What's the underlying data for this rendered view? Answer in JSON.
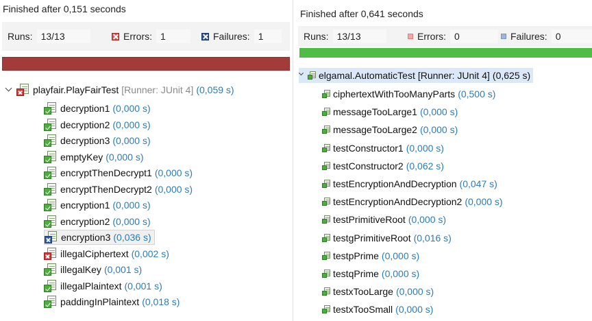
{
  "left": {
    "finished": "Finished after 0,151 seconds",
    "runs_label": "Runs:",
    "runs_value": "13/13",
    "errors_label": "Errors:",
    "errors_value": "1",
    "failures_label": "Failures:",
    "failures_value": "1",
    "progress_color": "#a33b3b",
    "suite": {
      "name": "playfair.PlayFairTest",
      "runner": "[Runner: JUnit 4]",
      "time": "(0,059 s)",
      "status": "error"
    },
    "tests": [
      {
        "name": "decryption1",
        "time": "(0,000 s)",
        "status": "pass"
      },
      {
        "name": "decryption2",
        "time": "(0,000 s)",
        "status": "pass"
      },
      {
        "name": "decryption3",
        "time": "(0,000 s)",
        "status": "pass"
      },
      {
        "name": "emptyKey",
        "time": "(0,000 s)",
        "status": "pass"
      },
      {
        "name": "encryptThenDecrypt1",
        "time": "(0,000 s)",
        "status": "pass"
      },
      {
        "name": "encryptThenDecrypt2",
        "time": "(0,000 s)",
        "status": "pass"
      },
      {
        "name": "encryption1",
        "time": "(0,000 s)",
        "status": "pass"
      },
      {
        "name": "encryption2",
        "time": "(0,000 s)",
        "status": "pass"
      },
      {
        "name": "encryption3",
        "time": "(0,036 s)",
        "status": "failure"
      },
      {
        "name": "illegalCiphertext",
        "time": "(0,002 s)",
        "status": "error"
      },
      {
        "name": "illegalKey",
        "time": "(0,001 s)",
        "status": "pass"
      },
      {
        "name": "illegalPlaintext",
        "time": "(0,001 s)",
        "status": "pass"
      },
      {
        "name": "paddingInPlaintext",
        "time": "(0,018 s)",
        "status": "pass"
      }
    ]
  },
  "right": {
    "finished": "Finished after 0,641 seconds",
    "runs_label": "Runs:",
    "runs_value": "13/13",
    "errors_label": "Errors:",
    "errors_value": "0",
    "failures_label": "Failures:",
    "failures_value": "0",
    "progress_color": "#4ebc45",
    "progress_fraction": 1.0,
    "suite": {
      "name": "elgamal.AutomaticTest",
      "runner": "[Runner: JUnit 4]",
      "time": "(0,625 s)",
      "status": "pass"
    },
    "tests": [
      {
        "name": "ciphertextWithTooManyParts",
        "time": "(0,500 s)",
        "status": "pass"
      },
      {
        "name": "messageTooLarge1",
        "time": "(0,000 s)",
        "status": "pass"
      },
      {
        "name": "messageTooLarge2",
        "time": "(0,000 s)",
        "status": "pass"
      },
      {
        "name": "testConstructor1",
        "time": "(0,000 s)",
        "status": "pass"
      },
      {
        "name": "testConstructor2",
        "time": "(0,062 s)",
        "status": "pass"
      },
      {
        "name": "testEncryptionAndDecryption",
        "time": "(0,047 s)",
        "status": "pass"
      },
      {
        "name": "testEncryptionAndDecryption2",
        "time": "(0,000 s)",
        "status": "pass"
      },
      {
        "name": "testPrimitiveRoot",
        "time": "(0,000 s)",
        "status": "pass"
      },
      {
        "name": "testgPrimitiveRoot",
        "time": "(0,016 s)",
        "status": "pass"
      },
      {
        "name": "testpPrime",
        "time": "(0,000 s)",
        "status": "pass"
      },
      {
        "name": "testqPrime",
        "time": "(0,000 s)",
        "status": "pass"
      },
      {
        "name": "testxTooLarge",
        "time": "(0,000 s)",
        "status": "pass"
      },
      {
        "name": "testxTooSmall",
        "time": "(0,000 s)",
        "status": "pass"
      }
    ]
  }
}
